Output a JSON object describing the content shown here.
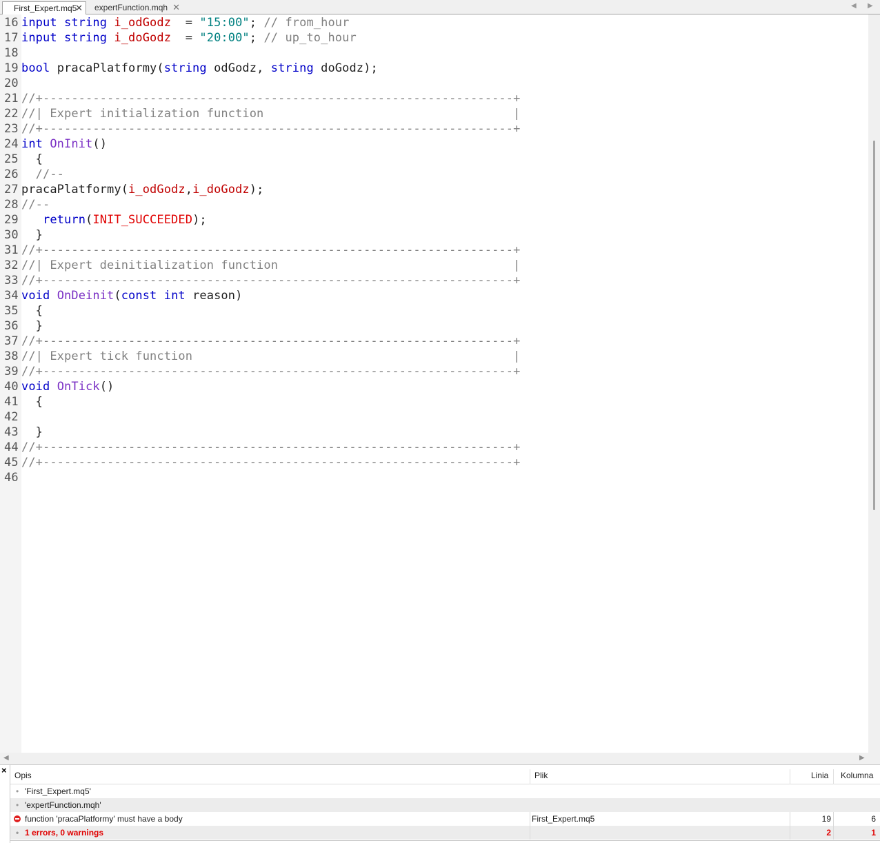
{
  "tabs": [
    {
      "label": "First_Expert.mq5",
      "active": true,
      "close_glyph": "✕"
    },
    {
      "label": "expertFunction.mqh",
      "active": false,
      "close_glyph": "✕"
    }
  ],
  "nav_arrows": {
    "left": "◀",
    "right": "▶"
  },
  "scroll_arrows": {
    "left": "◀",
    "right": "▶"
  },
  "code_lines": [
    {
      "n": "16",
      "t": [
        [
          "kw",
          "input "
        ],
        [
          "kw",
          "string "
        ],
        [
          "var",
          "i_odGodz"
        ],
        [
          "",
          "  = "
        ],
        [
          "str",
          "\"15:00\""
        ],
        [
          "",
          "; "
        ],
        [
          "cm",
          "// from_hour"
        ]
      ]
    },
    {
      "n": "17",
      "t": [
        [
          "kw",
          "input "
        ],
        [
          "kw",
          "string "
        ],
        [
          "var",
          "i_doGodz"
        ],
        [
          "",
          "  = "
        ],
        [
          "str",
          "\"20:00\""
        ],
        [
          "",
          "; "
        ],
        [
          "cm",
          "// up_to_hour"
        ]
      ]
    },
    {
      "n": "18",
      "t": []
    },
    {
      "n": "19",
      "t": [
        [
          "kw",
          "bool "
        ],
        [
          "",
          "pracaPlatformy("
        ],
        [
          "kw",
          "string "
        ],
        [
          "",
          "odGodz, "
        ],
        [
          "kw",
          "string "
        ],
        [
          "",
          "doGodz);"
        ]
      ]
    },
    {
      "n": "20",
      "t": []
    },
    {
      "n": "21",
      "t": [
        [
          "cm",
          "//+------------------------------------------------------------------+"
        ]
      ]
    },
    {
      "n": "22",
      "t": [
        [
          "cm",
          "//| Expert initialization function                                   |"
        ]
      ]
    },
    {
      "n": "23",
      "t": [
        [
          "cm",
          "//+------------------------------------------------------------------+"
        ]
      ]
    },
    {
      "n": "24",
      "t": [
        [
          "kw",
          "int "
        ],
        [
          "fn",
          "OnInit"
        ],
        [
          "",
          "()"
        ]
      ]
    },
    {
      "n": "25",
      "t": [
        [
          "",
          "  {"
        ]
      ]
    },
    {
      "n": "26",
      "t": [
        [
          "cm",
          "  //--"
        ]
      ]
    },
    {
      "n": "27",
      "t": [
        [
          "",
          "pracaPlatformy("
        ],
        [
          "var",
          "i_odGodz"
        ],
        [
          "",
          ","
        ],
        [
          "var",
          "i_doGodz"
        ],
        [
          "",
          ");"
        ]
      ]
    },
    {
      "n": "28",
      "t": [
        [
          "cm",
          "//--"
        ]
      ]
    },
    {
      "n": "29",
      "t": [
        [
          "",
          "   "
        ],
        [
          "kw",
          "return"
        ],
        [
          "",
          "("
        ],
        [
          "cst",
          "INIT_SUCCEEDED"
        ],
        [
          "",
          ");"
        ]
      ]
    },
    {
      "n": "30",
      "t": [
        [
          "",
          "  }"
        ]
      ]
    },
    {
      "n": "31",
      "t": [
        [
          "cm",
          "//+------------------------------------------------------------------+"
        ]
      ]
    },
    {
      "n": "32",
      "t": [
        [
          "cm",
          "//| Expert deinitialization function                                 |"
        ]
      ]
    },
    {
      "n": "33",
      "t": [
        [
          "cm",
          "//+------------------------------------------------------------------+"
        ]
      ]
    },
    {
      "n": "34",
      "t": [
        [
          "kw",
          "void "
        ],
        [
          "fn",
          "OnDeinit"
        ],
        [
          "",
          "("
        ],
        [
          "kw",
          "const "
        ],
        [
          "kw",
          "int "
        ],
        [
          "",
          "reason)"
        ]
      ]
    },
    {
      "n": "35",
      "t": [
        [
          "",
          "  {"
        ]
      ]
    },
    {
      "n": "36",
      "t": [
        [
          "",
          "  }"
        ]
      ]
    },
    {
      "n": "37",
      "t": [
        [
          "cm",
          "//+------------------------------------------------------------------+"
        ]
      ]
    },
    {
      "n": "38",
      "t": [
        [
          "cm",
          "//| Expert tick function                                             |"
        ]
      ]
    },
    {
      "n": "39",
      "t": [
        [
          "cm",
          "//+------------------------------------------------------------------+"
        ]
      ]
    },
    {
      "n": "40",
      "t": [
        [
          "kw",
          "void "
        ],
        [
          "fn",
          "OnTick"
        ],
        [
          "",
          "()"
        ]
      ]
    },
    {
      "n": "41",
      "t": [
        [
          "",
          "  {"
        ]
      ]
    },
    {
      "n": "42",
      "t": []
    },
    {
      "n": "43",
      "t": [
        [
          "",
          "  }"
        ]
      ]
    },
    {
      "n": "44",
      "t": [
        [
          "cm",
          "//+------------------------------------------------------------------+"
        ]
      ]
    },
    {
      "n": "45",
      "t": [
        [
          "cm",
          "//+------------------------------------------------------------------+"
        ]
      ]
    },
    {
      "n": "46",
      "t": []
    }
  ],
  "toolbox": {
    "close_glyph": "×",
    "columns": {
      "desc": "Opis",
      "file": "Plik",
      "line": "Linia",
      "col": "Kolumna"
    },
    "rows": [
      {
        "kind": "info",
        "desc": "'First_Expert.mq5'",
        "file": "",
        "line": "",
        "col": ""
      },
      {
        "kind": "info",
        "desc": "'expertFunction.mqh'",
        "file": "",
        "line": "",
        "col": ""
      },
      {
        "kind": "error",
        "desc": "function 'pracaPlatformy' must have a body",
        "file": "First_Expert.mq5",
        "line": "19",
        "col": "6"
      },
      {
        "kind": "summary",
        "desc": "1 errors, 0 warnings",
        "file": "",
        "line": "2",
        "col": "1"
      }
    ],
    "bullet": "•"
  }
}
